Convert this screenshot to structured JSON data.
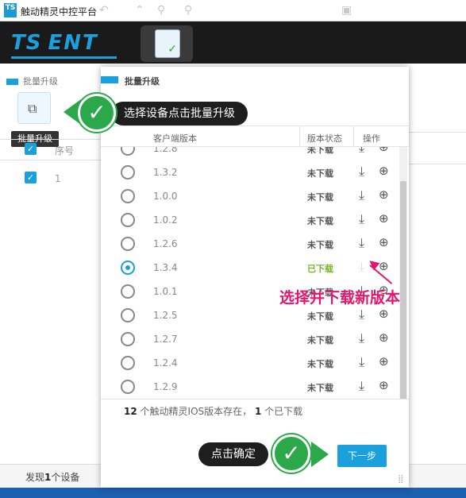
{
  "window": {
    "title": "触动精灵中控平台"
  },
  "header": {
    "brand_left": "TS",
    "brand_right": "ENT"
  },
  "left": {
    "section_title": "批量升级",
    "batch_button_tip": "批量升级",
    "column_seq": "序号",
    "row_seq": "1",
    "found_prefix": "发现",
    "found_count": "1",
    "found_suffix": "个设备"
  },
  "modal": {
    "title": "批量升级",
    "columns": {
      "version": "客户端版本",
      "status": "版本状态",
      "action": "操作"
    },
    "rows": [
      {
        "version": "1.2.8",
        "status": "未下载",
        "selected": false,
        "downloaded": false
      },
      {
        "version": "1.3.2",
        "status": "未下载",
        "selected": false,
        "downloaded": false
      },
      {
        "version": "1.0.0",
        "status": "未下载",
        "selected": false,
        "downloaded": false
      },
      {
        "version": "1.0.2",
        "status": "未下载",
        "selected": false,
        "downloaded": false
      },
      {
        "version": "1.2.6",
        "status": "未下载",
        "selected": false,
        "downloaded": false
      },
      {
        "version": "1.3.4",
        "status": "已下载",
        "selected": true,
        "downloaded": true
      },
      {
        "version": "1.0.1",
        "status": "未下载",
        "selected": false,
        "downloaded": false
      },
      {
        "version": "1.2.5",
        "status": "未下载",
        "selected": false,
        "downloaded": false
      },
      {
        "version": "1.2.7",
        "status": "未下载",
        "selected": false,
        "downloaded": false
      },
      {
        "version": "1.2.4",
        "status": "未下载",
        "selected": false,
        "downloaded": false
      },
      {
        "version": "1.2.9",
        "status": "未下载",
        "selected": false,
        "downloaded": false
      }
    ],
    "summary": {
      "total": "12",
      "mid": "个触动精灵IOS版本存在，",
      "downloaded": "1",
      "end": "个已下载"
    },
    "next_button": "下一步"
  },
  "callouts": {
    "top": "选择设备点击批量升级",
    "bottom": "点击确定",
    "red_note": "选择并下载新版本"
  },
  "colors": {
    "accent": "#1aa0dc",
    "badge_green": "#2aa84a",
    "downloaded_green": "#7ab427",
    "note_pink": "#e4166e"
  },
  "icons": {
    "download": "download-icon",
    "zoom": "zoom-in-icon",
    "check": "check-icon"
  }
}
